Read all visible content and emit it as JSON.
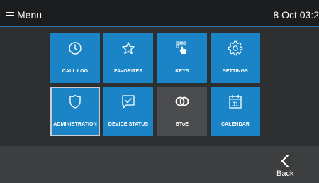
{
  "header": {
    "menu_icon": "hamburger-icon",
    "title": "Menu",
    "clock": "8 Oct 03:2"
  },
  "tiles": [
    {
      "label": "CALL LOG",
      "icon": "clock-icon"
    },
    {
      "label": "FAVORITES",
      "icon": "star-icon"
    },
    {
      "label": "KEYS",
      "icon": "keypad-touch-icon"
    },
    {
      "label": "SETTINGS",
      "icon": "gear-icon"
    },
    {
      "label": "ADMINISTRATION",
      "icon": "shield-icon"
    },
    {
      "label": "DEVICE STATUS",
      "icon": "device-check-icon"
    },
    {
      "label": "BToE",
      "icon": "linked-rings-icon"
    },
    {
      "label": "CALENDAR",
      "icon": "calendar-icon"
    }
  ],
  "footer": {
    "back_icon": "chevron-left-icon",
    "back_label": "Back"
  },
  "colors": {
    "tile_blue": "#1a84c7",
    "tile_dark": "#4b4c4e",
    "accent_line": "#2f78b7",
    "background": "#2e2f31"
  }
}
